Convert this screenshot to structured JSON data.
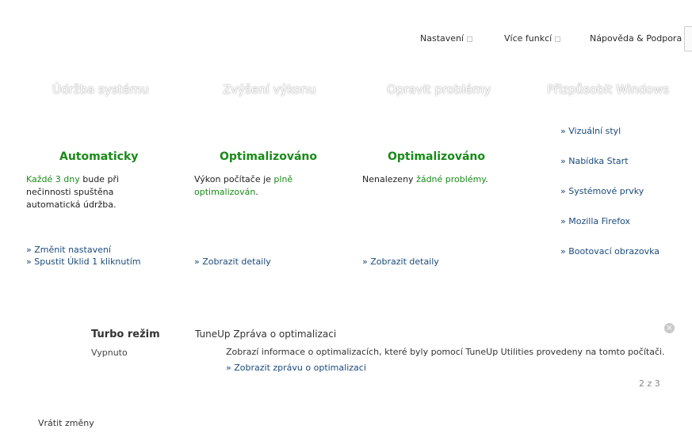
{
  "topmenu": {
    "settings": "Nastavení",
    "more": "Více funkcí",
    "help": "Nápověda & Podpora"
  },
  "categories": {
    "maintenance": "Údržba systému",
    "performance": "Zvýšení výkonu",
    "fix": "Opravit problémy",
    "customize": "Přizpůsobit Windows"
  },
  "maintenance": {
    "status": "Automaticky",
    "desc_highlight": "Každé 3 dny",
    "desc_rest": " bude při nečinnosti spuštěna automatická údržba.",
    "link_change": "» Změnit nastavení",
    "link_oneclick": "» Spustit Úklid 1 kliknutím"
  },
  "performance": {
    "status": "Optimalizováno",
    "desc_pre": "Výkon počítače je ",
    "desc_highlight": "plně optimalizován",
    "desc_post": ".",
    "link_details": "» Zobrazit detaily"
  },
  "fix": {
    "status": "Optimalizováno",
    "desc_pre": "Nenalezeny ",
    "desc_highlight": "žádné problémy",
    "desc_post": ".",
    "link_details": "» Zobrazit detaily"
  },
  "customize": {
    "items": [
      "» Vizuální styl",
      "» Nabídka Start",
      "» Systémové prvky",
      "» Mozilla Firefox",
      "» Bootovací obrazovka"
    ]
  },
  "turbo": {
    "title": "Turbo režim",
    "state": "Vypnuto"
  },
  "news": {
    "title": "TuneUp Zpráva o optimalizaci",
    "text": "Zobrazí informace o optimalizacích, které byly pomocí TuneUp Utilities provedeny na tomto počítači.",
    "link": "» Zobrazit zprávu o optimalizaci",
    "pager": "2 z 3",
    "close_glyph": "×"
  },
  "footer": {
    "undo": "Vrátit změny"
  },
  "colors": {
    "status_green": "#1a8a1a",
    "link_blue": "#1a4a7a"
  }
}
